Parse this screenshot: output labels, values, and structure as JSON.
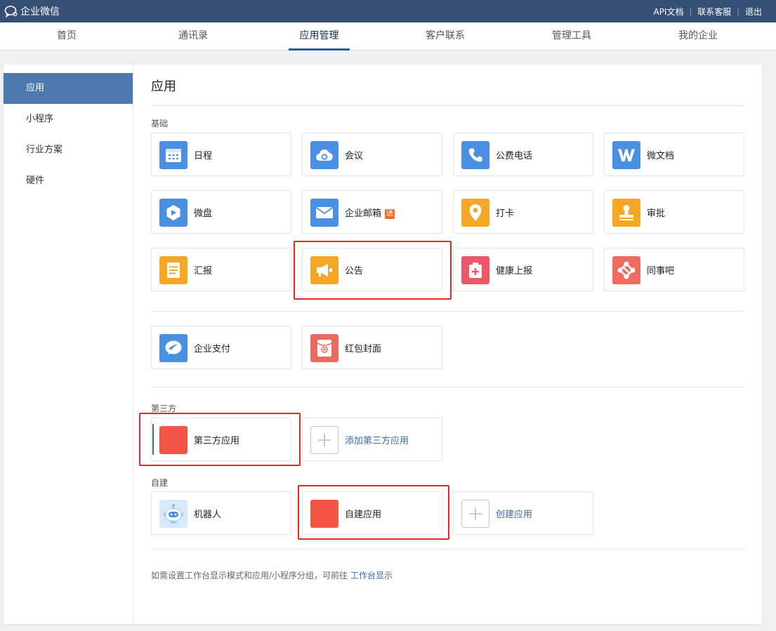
{
  "topbar": {
    "brand": "企业微信",
    "links": [
      "API文档",
      "联系客服",
      "退出"
    ]
  },
  "nav": {
    "tabs": [
      "首页",
      "通讯录",
      "应用管理",
      "客户联系",
      "管理工具",
      "我的企业"
    ],
    "active": "应用管理"
  },
  "sidebar": {
    "items": [
      "应用",
      "小程序",
      "行业方案",
      "硬件"
    ],
    "active": "应用"
  },
  "page": {
    "title": "应用",
    "sections": {
      "basic": "基础",
      "third": "第三方",
      "custom": "自建"
    }
  },
  "apps": {
    "basic": [
      {
        "name": "日程",
        "icon": "calendar-icon",
        "color": "#4a90e2"
      },
      {
        "name": "会议",
        "icon": "cloud-meeting-icon",
        "color": "#4a90e2"
      },
      {
        "name": "公费电话",
        "icon": "phone-icon",
        "color": "#4a90e2"
      },
      {
        "name": "微文档",
        "icon": "w-doc-icon",
        "color": "#4a90e2"
      },
      {
        "name": "微盘",
        "icon": "drive-box-icon",
        "color": "#4a90e2"
      },
      {
        "name": "企业邮箱",
        "icon": "mail-icon",
        "color": "#4a90e2",
        "badge": "送"
      },
      {
        "name": "打卡",
        "icon": "location-pin-icon",
        "color": "#f5a623"
      },
      {
        "name": "审批",
        "icon": "stamp-icon",
        "color": "#f5a623"
      },
      {
        "name": "汇报",
        "icon": "report-icon",
        "color": "#f5a623"
      },
      {
        "name": "公告",
        "icon": "megaphone-icon",
        "color": "#f5a623"
      },
      {
        "name": "健康上报",
        "icon": "medical-kit-icon",
        "color": "#f0566a"
      },
      {
        "name": "同事吧",
        "icon": "colleague-network-icon",
        "color": "#f06a60"
      }
    ],
    "extra": [
      {
        "name": "企业支付",
        "icon": "pay-icon",
        "color": "#4a90e2"
      },
      {
        "name": "红包封面",
        "icon": "red-packet-icon",
        "color": "#ea6a60"
      }
    ],
    "third": [
      {
        "name": "第三方应用",
        "icon": "third-party-app-icon",
        "color": "#f35444"
      },
      {
        "name": "添加第三方应用",
        "icon": "plus-icon"
      }
    ],
    "custom": [
      {
        "name": "机器人",
        "icon": "robot-icon",
        "color": "#a9cdf2"
      },
      {
        "name": "自建应用",
        "icon": "custom-app-icon",
        "color": "#f35444"
      },
      {
        "name": "创建应用",
        "icon": "plus-icon"
      }
    ]
  },
  "footer": {
    "note": "如需设置工作台显示模式和应用/小程序分组，可前往",
    "link": "工作台显示"
  },
  "colors": {
    "topbar": "#364f74",
    "accent": "#4d79b0",
    "highlight": "#e5262a",
    "link": "#3b6aa8"
  }
}
